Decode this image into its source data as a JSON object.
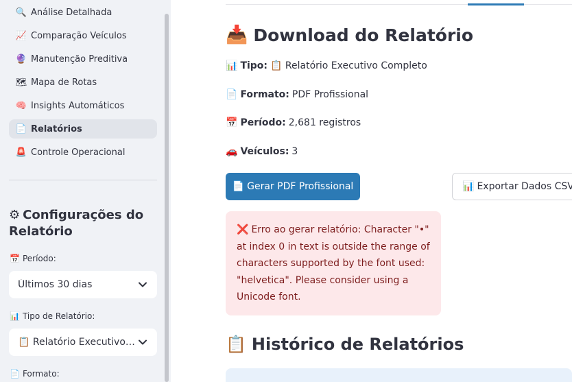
{
  "sidebar": {
    "nav_items": [
      {
        "label": "Análise Detalhada",
        "icon": "🔍"
      },
      {
        "label": "Comparação Veículos",
        "icon": "📈"
      },
      {
        "label": "Manutenção Preditiva",
        "icon": "🔮"
      },
      {
        "label": "Mapa de Rotas",
        "icon": "🗺"
      },
      {
        "label": "Insights Automáticos",
        "icon": "🧠"
      },
      {
        "label": "Relatórios",
        "icon": "📄"
      },
      {
        "label": "Controle Operacional",
        "icon": "🚨"
      }
    ],
    "settings_heading": "Configurações do Relatório",
    "settings_icon": "⚙",
    "periodo": {
      "label": "Período:",
      "icon": "📅",
      "value": "Últimos 30 dias"
    },
    "tipo": {
      "label": "Tipo de Relatório:",
      "icon": "📊",
      "value": "📋 Relatório Executivo Completo"
    },
    "formato": {
      "label": "Formato:",
      "icon": "📄"
    }
  },
  "main": {
    "download_title": "Download do Relatório",
    "download_icon": "📥",
    "meta": {
      "tipo_label": "Tipo:",
      "tipo_icon": "📊",
      "tipo_value": "📋 Relatório Executivo Completo",
      "formato_label": "Formato:",
      "formato_icon": "📄",
      "formato_value": "PDF Profissional",
      "periodo_label": "Período:",
      "periodo_icon": "📅",
      "periodo_value": "2,681 registros",
      "veiculos_label": "Veículos:",
      "veiculos_icon": "🚗",
      "veiculos_value": "3"
    },
    "generate_pdf_label": "Gerar PDF Profissional",
    "generate_pdf_icon": "📄",
    "export_csv_label": "Exportar Dados CSV",
    "export_csv_icon": "📊",
    "error_icon": "❌",
    "error_text": "Erro ao gerar relatório: Character \"•\" at index 0 in text is outside the range of characters supported by the font used: \"helvetica\". Please consider using a Unicode font.",
    "history_title": "Histórico de Relatórios",
    "history_icon": "📋"
  },
  "colors": {
    "primary": "#2c7ab5",
    "error_bg": "#fde8ea",
    "error_text": "#7d1d1d",
    "sidebar_bg": "#f0f2f6"
  }
}
